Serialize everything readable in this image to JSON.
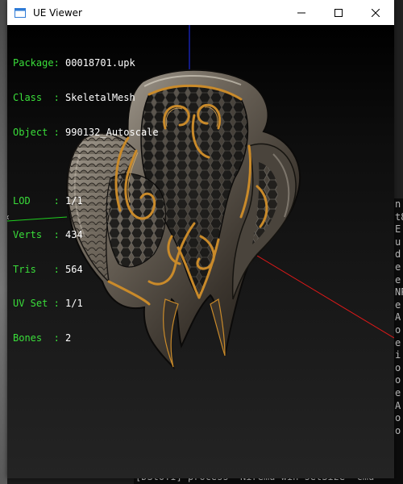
{
  "window": {
    "title": "UE Viewer",
    "controls": {
      "minimize": "minimize",
      "maximize": "maximize",
      "close": "close"
    }
  },
  "info": {
    "package_label": "Package:",
    "package_value": "00018701.upk",
    "class_label": "Class  :",
    "class_value": "SkeletalMesh",
    "object_label": "Object :",
    "object_value": "990132_Autoscale",
    "lod_label": "LOD    :",
    "lod_value": "1/1",
    "verts_label": "Verts  :",
    "verts_value": "434",
    "tris_label": "Tris   :",
    "tris_value": "564",
    "uvset_label": "UV Set :",
    "uvset_value": "1/1",
    "bones_label": "Bones  :",
    "bones_value": "2"
  },
  "console": {
    "lines": [
      "n",
      "t8",
      "E",
      "u",
      "d",
      "e",
      "e",
      "NP",
      "e",
      "A",
      "",
      "o",
      "e",
      "i",
      "o",
      "o",
      "e",
      "A",
      "",
      "o",
      "o",
      ""
    ],
    "bottom_line": "[DStoTI] process  Niremu win setSize  cmu"
  },
  "colors": {
    "label_green": "#3adf3a",
    "axis_red": "#e01818",
    "axis_green": "#1fd01f",
    "axis_blue": "#2030ff",
    "gold_trim": "#c98a2a"
  }
}
